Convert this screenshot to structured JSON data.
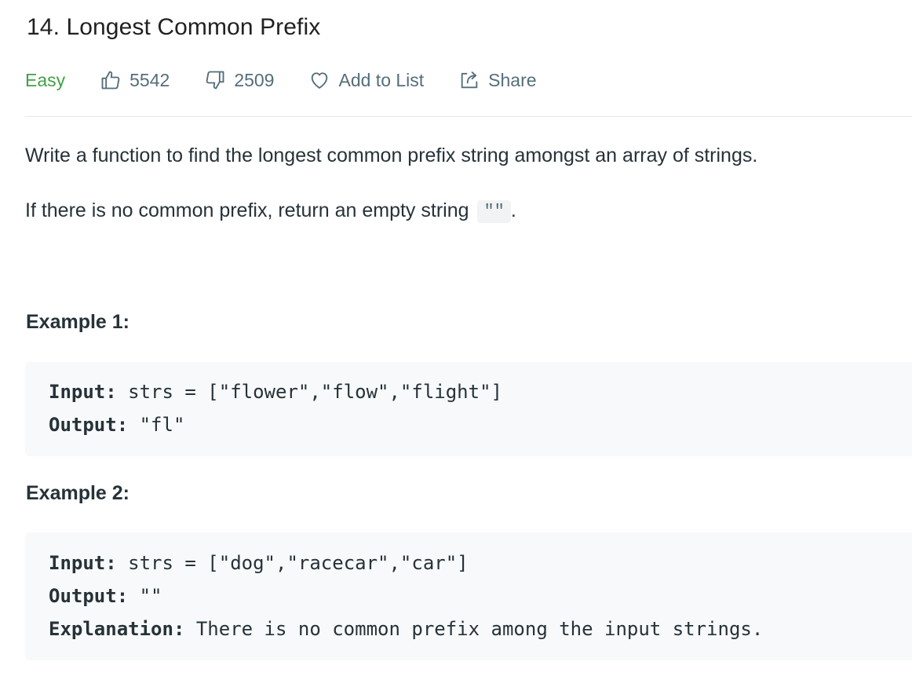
{
  "problem": {
    "title": "14. Longest Common Prefix",
    "difficulty": "Easy",
    "likes": "5542",
    "dislikes": "2509",
    "add_to_list_label": "Add to List",
    "share_label": "Share"
  },
  "description": {
    "paragraph1": "Write a function to find the longest common prefix string amongst an array of strings.",
    "paragraph2_text": "If there is no common prefix, return an empty string",
    "paragraph2_code": "\"\"",
    "paragraph2_end": "."
  },
  "examples": [
    {
      "heading": "Example 1:",
      "input_label": "Input:",
      "input_value": " strs = [\"flower\",\"flow\",\"flight\"]",
      "output_label": "Output:",
      "output_value": " \"fl\""
    },
    {
      "heading": "Example 2:",
      "input_label": "Input:",
      "input_value": " strs = [\"dog\",\"racecar\",\"car\"]",
      "output_label": "Output:",
      "output_value": " \"\"",
      "explanation_label": "Explanation:",
      "explanation_value": " There is no common prefix among the input strings."
    }
  ],
  "icons": {
    "like": "thumbs-up-icon",
    "dislike": "thumbs-down-icon",
    "add_to_list": "heart-icon",
    "share": "share-icon"
  },
  "colors": {
    "difficulty_easy": "#43a047",
    "meta_text": "#546e7a",
    "code_background": "#f7f9fa"
  }
}
